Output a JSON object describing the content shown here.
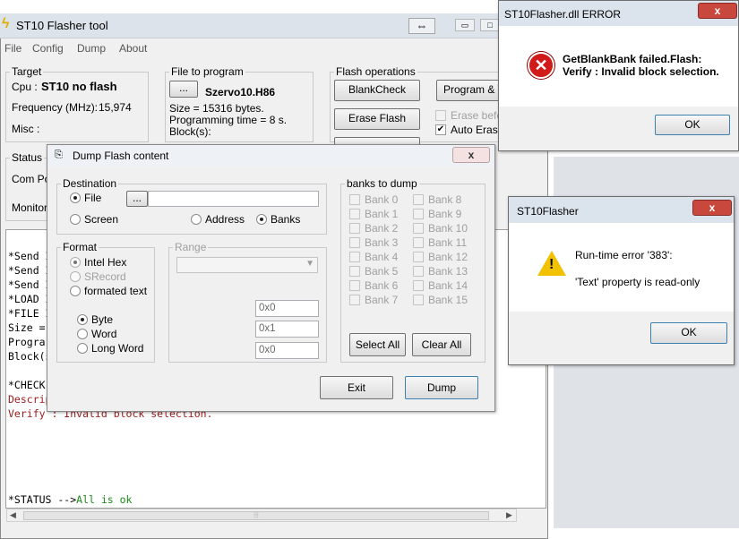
{
  "main_window": {
    "title": "ST10 Flasher tool",
    "menu": [
      "File",
      "Config",
      "Dump",
      "About"
    ],
    "target": {
      "legend": "Target",
      "cpu_label": "Cpu :",
      "cpu_value": "ST10 no flash",
      "freq_label": "Frequency (MHz):",
      "freq_value": "15,974",
      "misc_label": "Misc :"
    },
    "file_to_program": {
      "legend": "File to program",
      "browse": "...",
      "filename": "Szervo10.H86",
      "size": "Size = 15316 bytes.",
      "prog_time": "Programming time = 8 s.",
      "blocks": "Block(s):"
    },
    "flash_ops": {
      "legend": "Flash operations",
      "blank_check": "BlankCheck",
      "program_verify": "Program & Ve",
      "erase_flash": "Erase Flash",
      "erase_before": "Erase befo",
      "auto_erase": "Auto Erase"
    },
    "status": {
      "legend": "Status",
      "com_port": "Com Por",
      "monitor": "Monitor"
    },
    "log": [
      {
        "text": "*Send I",
        "color": "#000000"
      },
      {
        "text": "*Send I",
        "color": "#000000"
      },
      {
        "text": "*Send I",
        "color": "#000000"
      },
      {
        "text": "*LOAD I",
        "color": "#000000"
      },
      {
        "text": "*FILE I",
        "color": "#000000"
      },
      {
        "text": "Size =",
        "color": "#000000"
      },
      {
        "text": "Progra",
        "color": "#000000"
      },
      {
        "text": "Block(s):",
        "color": "#000000"
      },
      {
        "text": "",
        "color": "#000000"
      },
      {
        "text": "*CHECK IF BANKS ARE BLANK-->ERROR",
        "color": "#000000"
      },
      {
        "text": "Description: GetBlankBank failed.Flash:",
        "color": "#9b1b1b"
      },
      {
        "text": "Verify : Invalid block selection.",
        "color": "#9b1b1b"
      },
      {
        "text": "",
        "color": "#000000"
      }
    ],
    "status_line_prefix": "*STATUS -->",
    "status_line_value": "All is ok"
  },
  "dump_dialog": {
    "title": "Dump Flash content",
    "destination": {
      "legend": "Destination",
      "file": "File",
      "browse": "...",
      "screen": "Screen",
      "address": "Address",
      "banks": "Banks"
    },
    "format": {
      "legend": "Format",
      "intel_hex": "Intel Hex",
      "srecord": "SRecord",
      "formated_text": "formated text",
      "byte": "Byte",
      "word": "Word",
      "long_word": "Long Word"
    },
    "range": {
      "legend": "Range",
      "field1": "0x0",
      "field2": "0x1",
      "field3": "0x0"
    },
    "banks": {
      "legend": "banks to dump",
      "left": [
        "Bank 0",
        "Bank 1",
        "Bank 2",
        "Bank 3",
        "Bank 4",
        "Bank 5",
        "Bank 6",
        "Bank 7"
      ],
      "right": [
        "Bank 8",
        "Bank 9",
        "Bank 10",
        "Bank 11",
        "Bank 12",
        "Bank 13",
        "Bank 14",
        "Bank 15"
      ]
    },
    "select_all": "Select All",
    "clear_all": "Clear All",
    "exit": "Exit",
    "dump": "Dump"
  },
  "error_dialog": {
    "title": "ST10Flasher.dll ERROR",
    "line1": "GetBlankBank failed.Flash:",
    "line2": "Verify : Invalid block selection.",
    "ok": "OK",
    "close": "x"
  },
  "runtime_dialog": {
    "title": "ST10Flasher",
    "line1": "Run-time error '383':",
    "line2": "'Text' property is read-only",
    "ok": "OK",
    "close": "x"
  },
  "colors": {
    "error_text": "#9b1b1b",
    "ok_text": "#1a8a1a",
    "title_bar": "#dbe3ec"
  }
}
